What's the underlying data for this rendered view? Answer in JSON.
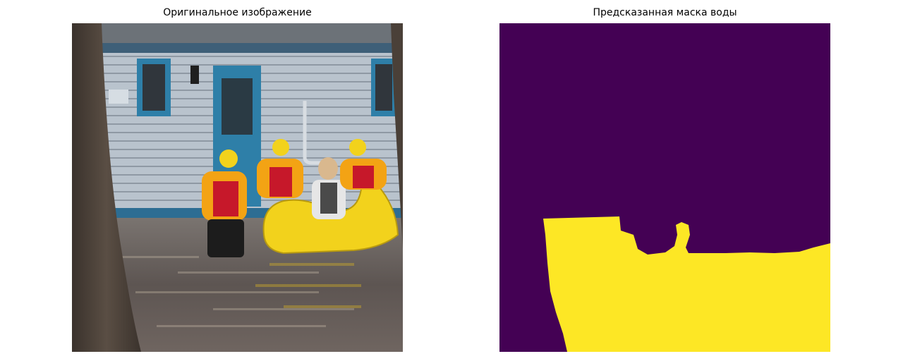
{
  "figure": {
    "left_title": "Оригинальное изображение",
    "right_title": "Предсказанная маска воды"
  },
  "colors": {
    "mask_background": "#440154",
    "mask_water": "#fde725",
    "raft": "#f2d21c",
    "house_siding": "#b8c2cc",
    "house_trim": "#2e7fa8",
    "water": "#6b6460",
    "tree_bark": "#4a4038"
  },
  "icons": {
    "photo": "flood-rescue-photo",
    "mask": "water-segmentation-mask"
  }
}
